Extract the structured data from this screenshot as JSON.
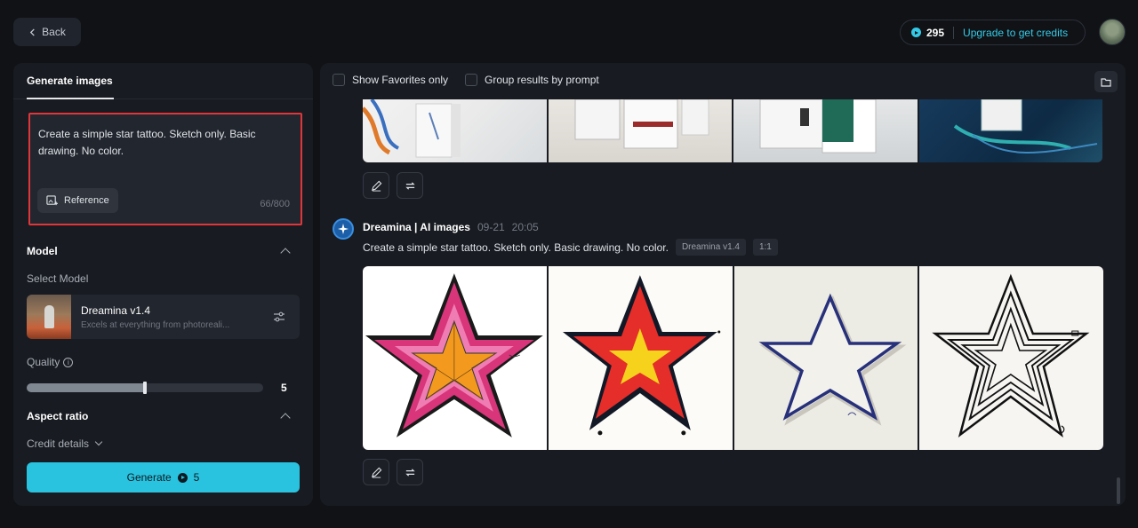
{
  "topbar": {
    "back_label": "Back",
    "credits": "295",
    "upgrade_label": "Upgrade to get credits"
  },
  "left_panel": {
    "tab_label": "Generate images",
    "prompt_text": "Create a simple star tattoo. Sketch only. Basic drawing. No color.",
    "reference_label": "Reference",
    "char_count": "66/800",
    "model_section": "Model",
    "select_model_label": "Select Model",
    "model_name": "Dreamina v1.4",
    "model_description": "Excels at everything from photoreali...",
    "quality_label": "Quality",
    "quality_value": "5",
    "quality_fraction": 0.5,
    "aspect_ratio_label": "Aspect ratio",
    "credit_details_label": "Credit details",
    "generate_label": "Generate",
    "generate_cost": "5"
  },
  "main_panel": {
    "filter_favorites": "Show Favorites only",
    "filter_group": "Group results by prompt",
    "message": {
      "sender": "Dreamina | AI images",
      "date": "09-21",
      "time": "20:05",
      "prompt": "Create a simple star tattoo. Sketch only. Basic drawing. No color.",
      "model_tag": "Dreamina v1.4",
      "ratio_tag": "1:1"
    }
  },
  "colors": {
    "accent": "#29c3df",
    "highlight_border": "#e0363b",
    "panel_bg": "#181b21",
    "page_bg": "#101216"
  },
  "icons": [
    "chevron-left-icon",
    "credit-coin-icon",
    "reference-image-icon",
    "settings-sliders-icon",
    "info-icon",
    "chevron-up-icon",
    "chevron-down-icon",
    "folder-icon",
    "edit-icon",
    "regenerate-icon",
    "dreamina-logo-icon"
  ]
}
